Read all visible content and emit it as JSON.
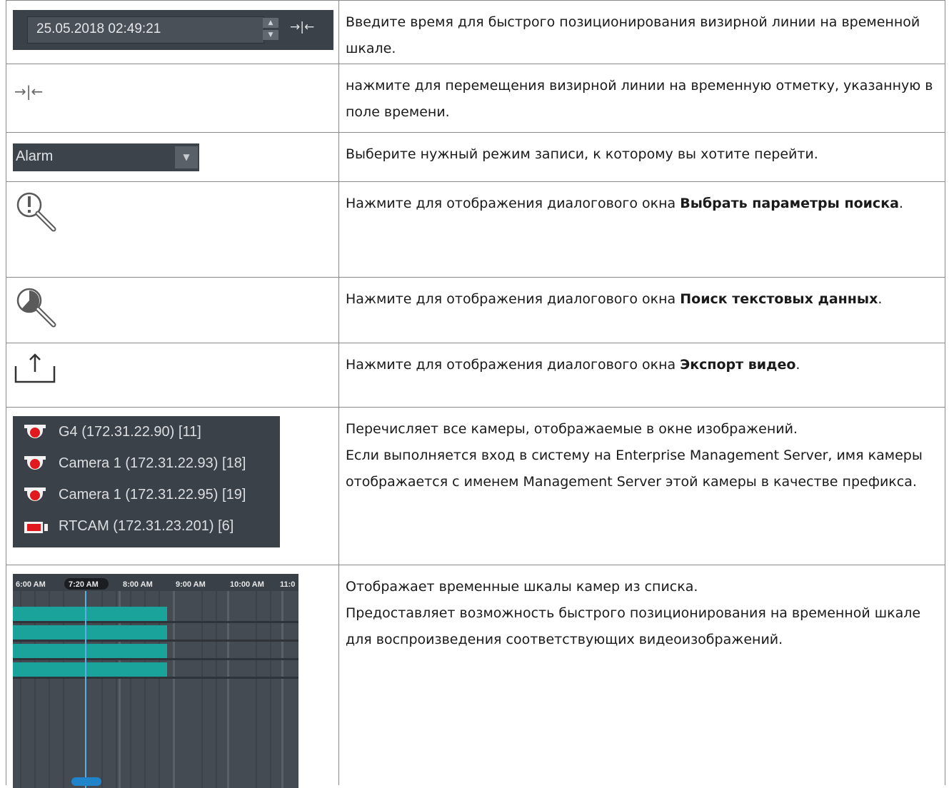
{
  "rows": [
    {
      "widget": {
        "date_value": "25.05.2018 02:49:21",
        "jump_glyph": "→|←"
      },
      "desc": "Введите время для быстрого позиционирования визирной линии на временной шкале."
    },
    {
      "widget": {
        "icon": "jump-to-time-icon",
        "glyph": "→|←"
      },
      "desc": "нажмите для перемещения визирной линии на временную отметку, указанную в поле времени."
    },
    {
      "widget": {
        "select_value": "Alarm"
      },
      "desc": "Выберите нужный режим записи, к которому вы хотите перейти."
    },
    {
      "widget": {
        "icon": "search-parameters-icon"
      },
      "desc_before": "Нажмите для отображения диалогового окна ",
      "desc_bold": "Выбрать параметры поиска",
      "desc_after": "."
    },
    {
      "widget": {
        "icon": "text-data-search-icon"
      },
      "desc_before": "Нажмите для отображения диалогового окна ",
      "desc_bold": "Поиск текстовых данных",
      "desc_after": "."
    },
    {
      "widget": {
        "icon": "export-icon"
      },
      "desc_before": "Нажмите для отображения диалогового окна ",
      "desc_bold": "Экспорт видео",
      "desc_after": "."
    },
    {
      "widget": {
        "cameras": [
          {
            "name": "G4 (172.31.22.90) [11]",
            "icon": "dome-camera-icon"
          },
          {
            "name": "Camera 1 (172.31.22.93) [18]",
            "icon": "dome-camera-icon"
          },
          {
            "name": "Camera 1 (172.31.22.95) [19]",
            "icon": "dome-camera-icon"
          },
          {
            "name": "RTCAM (172.31.23.201) [6]",
            "icon": "box-camera-icon"
          }
        ]
      },
      "desc_lines": [
        "Перечисляет все камеры, отображаемые в окне изображений.",
        "Если выполняется вход в систему на Enterprise Management Server, имя камеры отображается с именем Management Server этой камеры в качестве префикса."
      ]
    },
    {
      "widget": {
        "timeline_labels": [
          "6:00 AM",
          "7:20 AM",
          "8:00 AM",
          "9:00 AM",
          "10:00 AM",
          "11:0"
        ],
        "current_time": "7:20 AM"
      },
      "desc_lines": [
        "Отображает временные шкалы камер из списка.",
        "Предоставляет возможность быстрого позиционирования на временной шкале для воспроизведения соответствующих видеоизображений."
      ]
    }
  ],
  "colors": {
    "panel": "#3b4148",
    "recording": "#1aa39a",
    "cursor": "#5ab0e0",
    "alarm_red": "#e0191f"
  }
}
